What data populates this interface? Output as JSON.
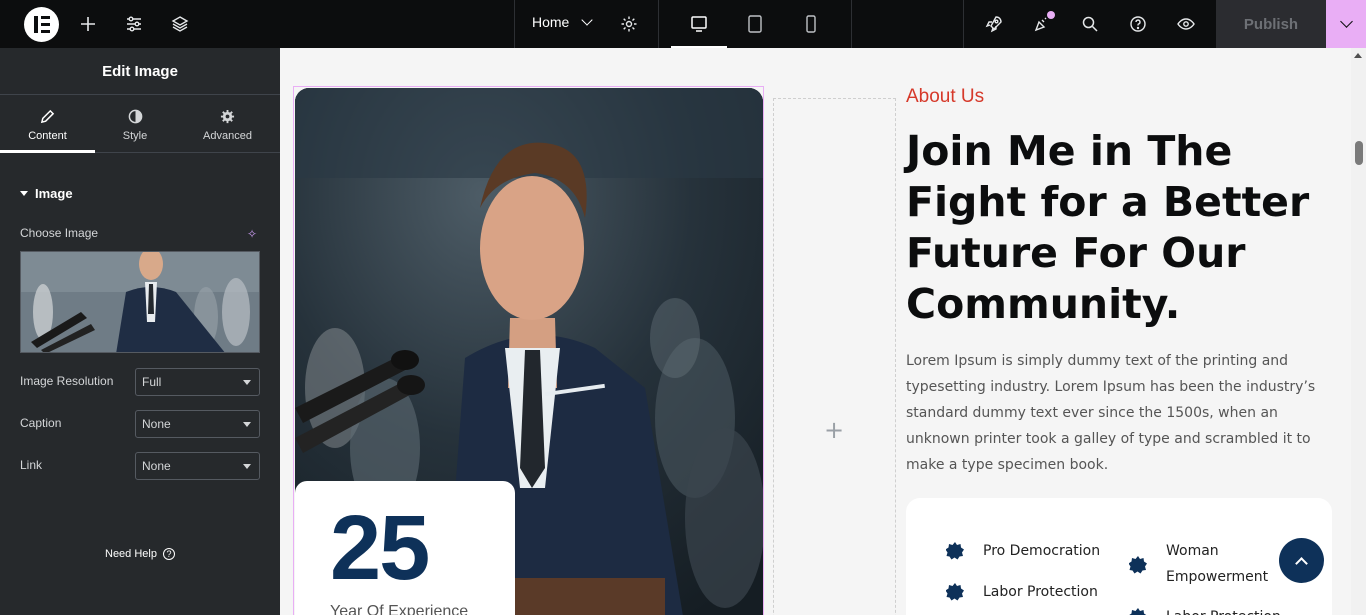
{
  "topbar": {
    "page_name": "Home",
    "publish_label": "Publish",
    "colors": {
      "bar": "#0c0d0e",
      "accent": "#e9aef5"
    }
  },
  "panel": {
    "title": "Edit Image",
    "tabs": [
      {
        "label": "Content",
        "icon": "pencil-icon",
        "active": true
      },
      {
        "label": "Style",
        "icon": "half-circle-icon",
        "active": false
      },
      {
        "label": "Advanced",
        "icon": "gear-icon",
        "active": false
      }
    ],
    "section_title": "Image",
    "choose_image_label": "Choose Image",
    "fields": [
      {
        "label": "Image Resolution",
        "value": "Full"
      },
      {
        "label": "Caption",
        "value": "None"
      },
      {
        "label": "Link",
        "value": "None"
      }
    ],
    "need_help": "Need Help"
  },
  "content": {
    "experience_number": "25",
    "experience_label": "Year Of Experience",
    "eyebrow": "About Us",
    "headline": "Join Me in The Fight for a Better Future For Our Community.",
    "body": "Lorem Ipsum is simply dummy text of the printing and typesetting industry. Lorem Ipsum has been the industry’s standard dummy text ever since the 1500s, when an unknown printer took a galley of type and scrambled it to make a type specimen book.",
    "features": [
      "Pro Democration",
      "Labor Protection",
      "Woman Empowerment",
      "Labor Protection"
    ],
    "colors": {
      "eyebrow": "#d6392a",
      "navy": "#0e3159"
    }
  }
}
